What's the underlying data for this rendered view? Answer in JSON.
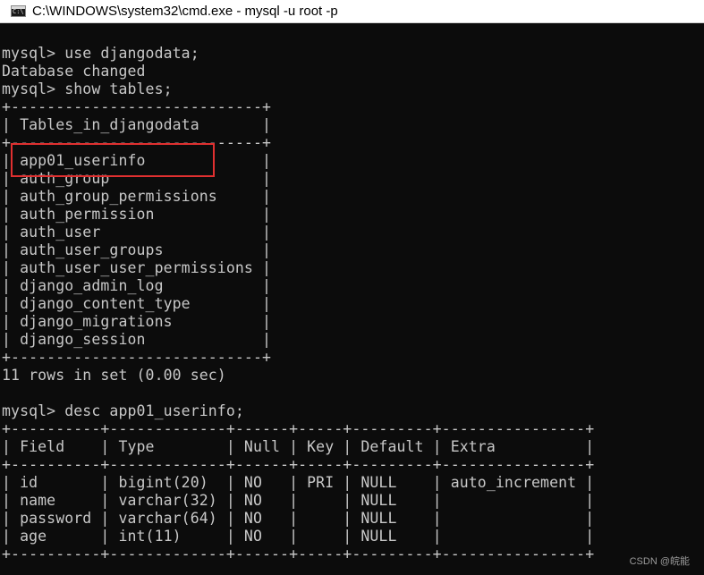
{
  "window": {
    "title": "C:\\WINDOWS\\system32\\cmd.exe - mysql  -u root -p",
    "icon": "cmd-app-icon"
  },
  "console": {
    "lines": [
      "mysql> use djangodata;",
      "Database changed",
      "mysql> show tables;",
      "+----------------------------+",
      "| Tables_in_djangodata       |",
      "+----------------------------+",
      "| app01_userinfo             |",
      "| auth_group                 |",
      "| auth_group_permissions     |",
      "| auth_permission            |",
      "| auth_user                  |",
      "| auth_user_groups           |",
      "| auth_user_user_permissions |",
      "| django_admin_log           |",
      "| django_content_type        |",
      "| django_migrations          |",
      "| django_session             |",
      "+----------------------------+",
      "11 rows in set (0.00 sec)",
      "",
      "mysql> desc app01_userinfo;",
      "+----------+-------------+------+-----+---------+----------------+",
      "| Field    | Type        | Null | Key | Default | Extra          |",
      "+----------+-------------+------+-----+---------+----------------+",
      "| id       | bigint(20)  | NO   | PRI | NULL    | auto_increment |",
      "| name     | varchar(32) | NO   |     | NULL    |                |",
      "| password | varchar(64) | NO   |     | NULL    |                |",
      "| age      | int(11)     | NO   |     | NULL    |                |",
      "+----------+-------------+------+-----+---------+----------------+"
    ]
  },
  "annotation": {
    "highlight_color": "#e03030"
  },
  "watermark": "CSDN @皖能",
  "colors": {
    "console_bg": "#0c0c0c",
    "console_fg": "#c8c8c8",
    "titlebar_bg": "#ffffff"
  }
}
